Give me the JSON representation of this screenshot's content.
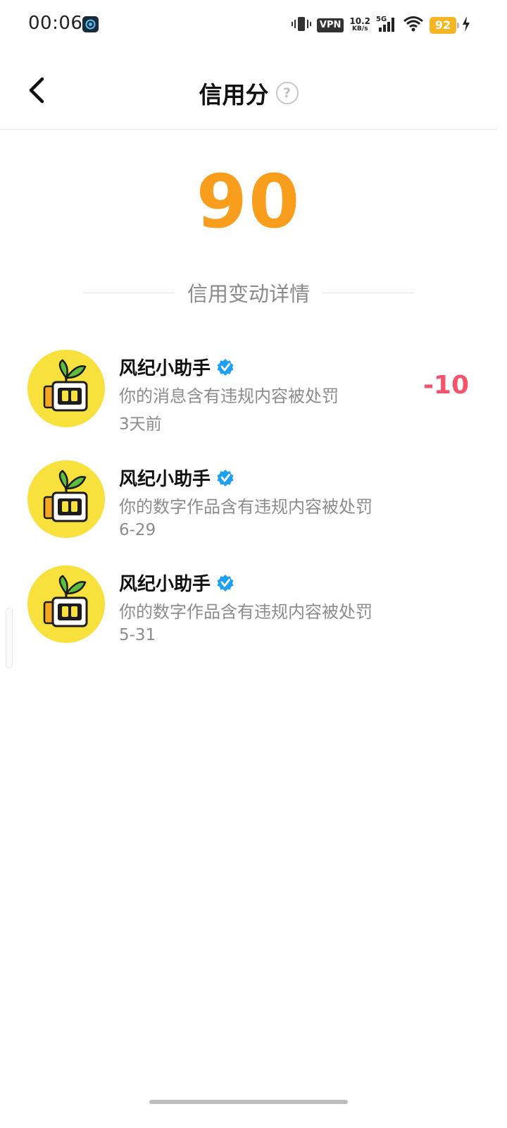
{
  "status_bar": {
    "time": "00:06",
    "vpn": "VPN",
    "net_speed_value": "10.2",
    "net_speed_unit": "KB/s",
    "signal_label": "5G",
    "battery": "92"
  },
  "header": {
    "title": "信用分",
    "help_icon": "question-circle-icon",
    "back_icon": "chevron-left-icon"
  },
  "score": {
    "value": "90",
    "color": "#f99d1c"
  },
  "section": {
    "title": "信用变动详情"
  },
  "records": [
    {
      "name": "风纪小助手",
      "description": "你的消息含有违规内容被处罚",
      "time": "3天前",
      "change": "-10"
    },
    {
      "name": "风纪小助手",
      "description": "你的数字作品含有违规内容被处罚",
      "time": "6-29",
      "change": ""
    },
    {
      "name": "风纪小助手",
      "description": "你的数字作品含有违规内容被处罚",
      "time": "5-31",
      "change": ""
    }
  ],
  "colors": {
    "accent_orange": "#f99d1c",
    "penalty_red": "#f2546e",
    "verified_blue": "#1ea1f2",
    "avatar_yellow": "#f8e03d"
  }
}
